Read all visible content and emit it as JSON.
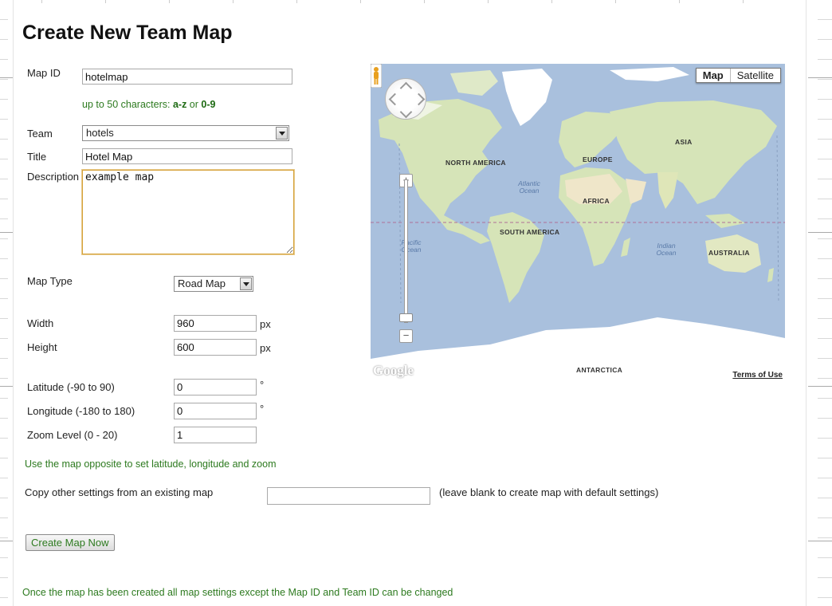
{
  "page_title": "Create New Team Map",
  "form": {
    "map_id": {
      "label": "Map ID",
      "value": "hotelmap",
      "hint_prefix": "up to 50 characters: ",
      "hint_az": "a-z",
      "hint_or": " or ",
      "hint_09": "0-9"
    },
    "team": {
      "label": "Team",
      "value": "hotels"
    },
    "title": {
      "label": "Title",
      "value": "Hotel Map"
    },
    "description": {
      "label": "Description",
      "value": "example map"
    },
    "map_type": {
      "label": "Map Type",
      "value": "Road Map"
    },
    "width": {
      "label": "Width",
      "value": "960",
      "unit": "px"
    },
    "height": {
      "label": "Height",
      "value": "600",
      "unit": "px"
    },
    "latitude": {
      "label": "Latitude (-90 to 90)",
      "value": "0",
      "unit": "°"
    },
    "longitude": {
      "label": "Longitude (-180 to 180)",
      "value": "0",
      "unit": "°"
    },
    "zoom": {
      "label": "Zoom Level (0 - 20)",
      "value": "1"
    },
    "map_hint": "Use the map opposite to set latitude, longitude and zoom",
    "copy": {
      "label": "Copy other settings from an existing map",
      "value": "",
      "note": "(leave blank to create map with default settings)"
    },
    "submit_label": "Create Map Now",
    "footer_note": "Once the map has been created all map settings except the Map ID and Team ID can be changed"
  },
  "map": {
    "type_buttons": [
      "Map",
      "Satellite"
    ],
    "active_type": "Map",
    "logo": "Google",
    "terms": "Terms of Use",
    "continent_labels": [
      "NORTH AMERICA",
      "EUROPE",
      "ASIA",
      "AFRICA",
      "SOUTH AMERICA",
      "AUSTRALIA",
      "ANTARCTICA"
    ],
    "ocean_labels": [
      "Atlantic Ocean",
      "Pacific Ocean",
      "Indian Ocean"
    ],
    "icons": [
      "pan-control-icon",
      "pegman-icon",
      "zoom-in-icon",
      "zoom-out-icon"
    ],
    "colors": {
      "water": "#a9c0dd",
      "land": "#d6e4b8",
      "desert": "#efe6c9",
      "ice": "#ffffff"
    }
  }
}
